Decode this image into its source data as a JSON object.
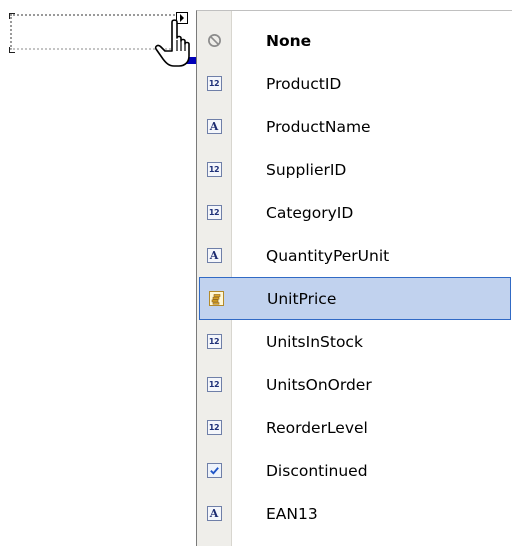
{
  "dropdown": {
    "items": [
      {
        "label": "None",
        "icon": "none-icon",
        "bold": true,
        "selected": false
      },
      {
        "label": "ProductID",
        "icon": "number-icon",
        "icon_text": "12",
        "selected": false
      },
      {
        "label": "ProductName",
        "icon": "text-icon",
        "icon_text": "A",
        "selected": false
      },
      {
        "label": "SupplierID",
        "icon": "number-icon",
        "icon_text": "12",
        "selected": false
      },
      {
        "label": "CategoryID",
        "icon": "number-icon",
        "icon_text": "12",
        "selected": false
      },
      {
        "label": "QuantityPerUnit",
        "icon": "text-icon",
        "icon_text": "A",
        "selected": false
      },
      {
        "label": "UnitPrice",
        "icon": "currency-icon",
        "selected": true
      },
      {
        "label": "UnitsInStock",
        "icon": "number-icon",
        "icon_text": "12",
        "selected": false
      },
      {
        "label": "UnitsOnOrder",
        "icon": "number-icon",
        "icon_text": "12",
        "selected": false
      },
      {
        "label": "ReorderLevel",
        "icon": "number-icon",
        "icon_text": "12",
        "selected": false
      },
      {
        "label": "Discontinued",
        "icon": "checkbox-icon",
        "selected": false
      },
      {
        "label": "EAN13",
        "icon": "text-icon",
        "icon_text": "A",
        "selected": false
      }
    ]
  },
  "colors": {
    "selection_fill": "#c1d2ee",
    "selection_border": "#316ac5",
    "gutter": "#efeeea",
    "handle": "#0000b8"
  }
}
